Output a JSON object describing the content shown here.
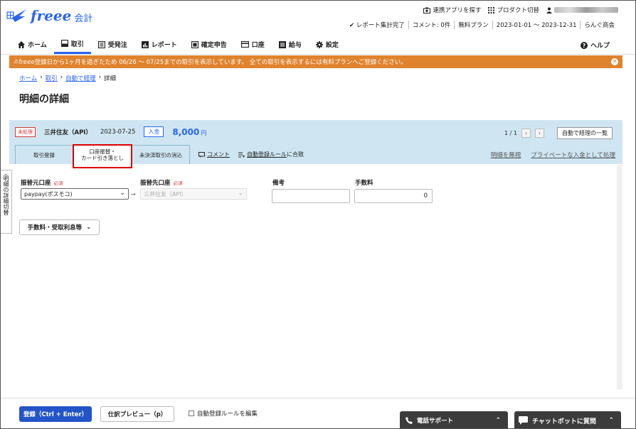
{
  "header": {
    "logo_text": "freee",
    "logo_sub": "会計",
    "links": {
      "connect_app": "連携アプリを探す",
      "products": "プロダクト切替"
    },
    "status": {
      "report": "レポート集計完了",
      "comment": "コメント: 0件",
      "plan": "無料プラン",
      "period": "2023-01-01 ～ 2023-12-31",
      "company": "らんぐ商会"
    }
  },
  "nav": {
    "items": [
      {
        "label": "ホーム"
      },
      {
        "label": "取引"
      },
      {
        "label": "受発注"
      },
      {
        "label": "レポート"
      },
      {
        "label": "確定申告"
      },
      {
        "label": "口座"
      },
      {
        "label": "給与"
      },
      {
        "label": "設定"
      }
    ],
    "help": "ヘルプ"
  },
  "banner": {
    "text": "freee登録日から1ヶ月を過ぎたため 06/26 ～ 07/25までの取引を表示しています。 全ての取引を表示するには有料プランへご登録ください。"
  },
  "breadcrumb": {
    "home": "ホーム",
    "deals": "取引",
    "auto": "自動で経理",
    "current": "詳細"
  },
  "page_title": "明細の詳細",
  "detail": {
    "status_badge": "未処理",
    "bank": "三井住友（API）",
    "date": "2023-07-25",
    "type_badge": "入金",
    "amount": "8,000",
    "currency": "円",
    "pager": "1 / 1",
    "back_button": "自動で経理の一覧"
  },
  "tabs": {
    "register": "取引登録",
    "transfer_line1": "口座振替・",
    "transfer_line2": "カード引き落とし",
    "settle": "未決済取引の消込",
    "comment": "コメント",
    "rule_prefix": "自動登録ルール",
    "rule_suffix": "に合致",
    "ignore": "明細を無視",
    "private": "プライベートな入金として処理"
  },
  "form": {
    "side_tab": "明細の詳細切替",
    "from_label": "振替元口座",
    "to_label": "振替先口座",
    "required": "必須",
    "from_value": "paypay(ポスモコ)",
    "to_value": "三井住友（API）",
    "memo_label": "備考",
    "fee_label": "手数料",
    "fee_value": "0",
    "fee_button": "手数料・受取利息等"
  },
  "footer": {
    "save": "登録（Ctrl + Enter）",
    "preview": "仕訳プレビュー（p）",
    "rule_edit": "自動登録ルールを編集",
    "phone": "電話サポート",
    "chat": "チャットボットに質問"
  }
}
